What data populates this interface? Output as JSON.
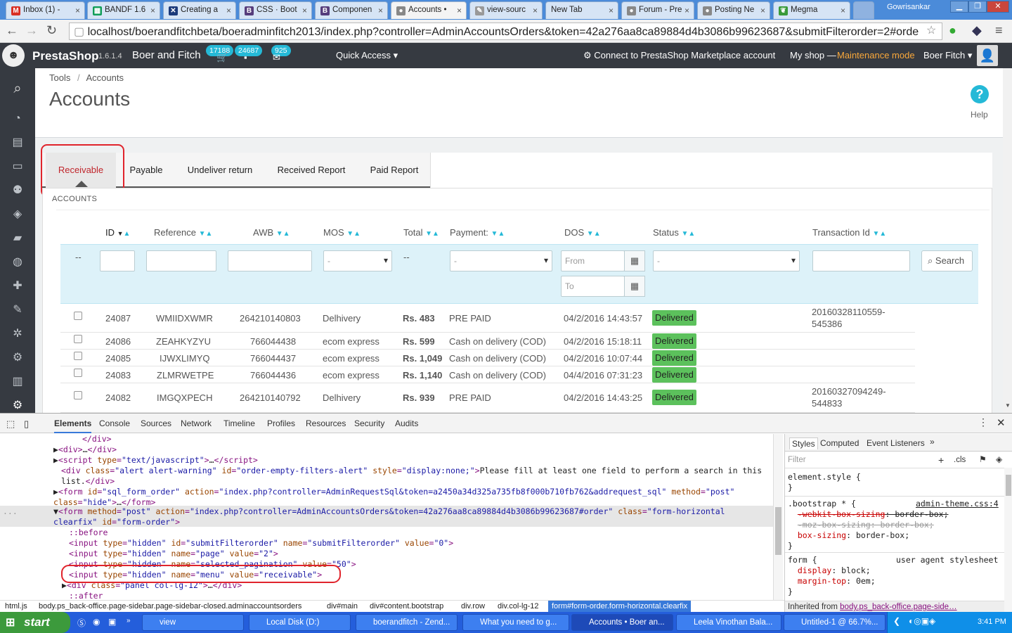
{
  "browser": {
    "tabs": [
      {
        "label": "Inbox (1) -",
        "icon": "gmail-icon"
      },
      {
        "label": "BANDF 1.6",
        "icon": "sheets-icon"
      },
      {
        "label": "Creating a",
        "icon": "x-icon"
      },
      {
        "label": "CSS · Boot",
        "icon": "bootstrap-icon"
      },
      {
        "label": "Componen",
        "icon": "bootstrap-icon"
      },
      {
        "label": "Accounts •",
        "icon": "prestashop-icon",
        "active": true
      },
      {
        "label": "view-sourc",
        "icon": "tool-icon"
      },
      {
        "label": "New Tab",
        "icon": ""
      },
      {
        "label": "Forum - Pre",
        "icon": "prestashop-icon"
      },
      {
        "label": "Posting Ne",
        "icon": "prestashop-icon"
      },
      {
        "label": "Megma",
        "icon": "leaf-icon"
      }
    ],
    "window_user": "Gowrisankar",
    "url": "localhost/boerandfitchbeta/boeradminfitch2013/index.php?controller=AdminAccountsOrders&token=42a276aa8ca89884d4b3086b99623687&submitFilterorder=2#orde"
  },
  "header": {
    "brand": "PrestaShop",
    "version": "1.6.1.4",
    "shop_name": "Boer and Fitch",
    "badges": [
      "17188",
      "24687",
      "925"
    ],
    "quick_access": "Quick Access",
    "connect": "Connect to PrestaShop Marketplace account",
    "my_shop": "My shop —",
    "maintenance": "Maintenance mode",
    "user": "Boer Fitch"
  },
  "breadcrumb": {
    "parent": "Tools",
    "sep": "/",
    "current": "Accounts"
  },
  "page_title": "Accounts",
  "help_label": "Help",
  "tabs": [
    "Receivable",
    "Payable",
    "Undeliver return",
    "Received Report",
    "Paid Report"
  ],
  "panel_heading": "ACCOUNTS",
  "table": {
    "headers": [
      "ID",
      "Reference",
      "AWB",
      "MOS",
      "Total",
      "Payment:",
      "DOS",
      "Status",
      "Transaction Id"
    ],
    "filters": {
      "dash1": "--",
      "dash2": "--",
      "mos_select": "-",
      "payment_select": "-",
      "status_select": "-",
      "from_placeholder": "From",
      "to_placeholder": "To",
      "search_label": "Search"
    },
    "rows": [
      {
        "id": "24087",
        "ref": "WMIIDXWMR",
        "awb": "264210140803",
        "mos": "Delhivery",
        "total_prefix": "Rs.",
        "total": "483",
        "payment": "PRE PAID",
        "dos": "04/2/2016 14:43:57",
        "status": "Delivered",
        "txn1": "20160328110559-",
        "txn2": "545386"
      },
      {
        "id": "24086",
        "ref": "ZEAHKYZYU",
        "awb": "766044438",
        "mos": "ecom express",
        "total_prefix": "Rs.",
        "total": "599",
        "payment": "Cash on delivery (COD)",
        "dos": "04/2/2016 15:18:11",
        "status": "Delivered",
        "txn1": "",
        "txn2": ""
      },
      {
        "id": "24085",
        "ref": "IJWXLIMYQ",
        "awb": "766044437",
        "mos": "ecom express",
        "total_prefix": "Rs.",
        "total": "1,049",
        "payment": "Cash on delivery (COD)",
        "dos": "04/2/2016 10:07:44",
        "status": "Delivered",
        "txn1": "",
        "txn2": ""
      },
      {
        "id": "24083",
        "ref": "ZLMRWETPE",
        "awb": "766044436",
        "mos": "ecom express",
        "total_prefix": "Rs.",
        "total": "1,140",
        "payment": "Cash on delivery (COD)",
        "dos": "04/4/2016 07:31:23",
        "status": "Delivered",
        "txn1": "",
        "txn2": ""
      },
      {
        "id": "24082",
        "ref": "IMGQXPECH",
        "awb": "264210140792",
        "mos": "Delhivery",
        "total_prefix": "Rs.",
        "total": "939",
        "payment": "PRE PAID",
        "dos": "04/2/2016 14:43:25",
        "status": "Delivered",
        "txn1": "20160327094249-",
        "txn2": "544833"
      }
    ]
  },
  "devtools": {
    "tabs": [
      "Elements",
      "Console",
      "Sources",
      "Network",
      "Timeline",
      "Profiles",
      "Resources",
      "Security",
      "Audits"
    ],
    "style_tabs": [
      "Styles",
      "Computed",
      "Event Listeners"
    ],
    "filter_placeholder": "Filter",
    "cls_label": ".cls",
    "breadcrumbs": [
      "html.js",
      "body.ps_back-office.page-sidebar.page-sidebar-closed.adminaccountsorders",
      "div#main",
      "div#content.bootstrap",
      "div.row",
      "div.col-lg-12",
      "form#form-order.form-horizontal.clearfix"
    ],
    "inherited_label": "Inherited from",
    "inherited_value": "body.ps_back-office.page-side…"
  },
  "taskbar": {
    "start": "start",
    "items": [
      "view",
      "Local Disk (D:)",
      "boerandfitch - Zend...",
      "What you need to g...",
      "Accounts • Boer an...",
      "Leela Vinothan Bala...",
      "Untitled-1 @ 66.7%..."
    ],
    "clock": "3:41 PM"
  },
  "colors": {
    "accent": "#25b9d7",
    "highlight": "#e0242c",
    "delivered": "#5cc15c",
    "header": "#363a41"
  }
}
